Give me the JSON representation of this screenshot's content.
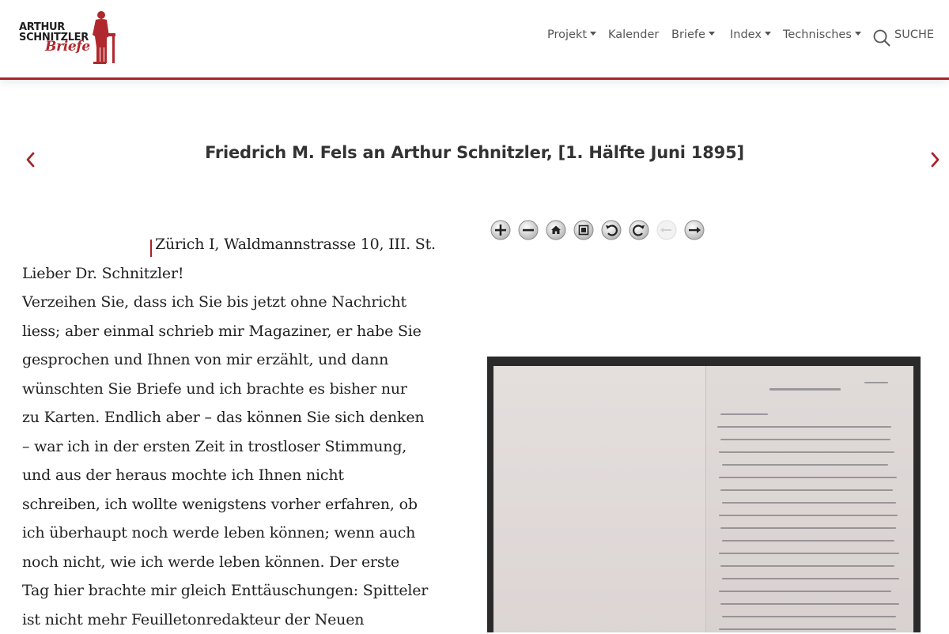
{
  "header": {
    "logo": {
      "line1": "ARTHUR",
      "line2": "SCHNITZLER",
      "line3": "Briefe"
    },
    "nav": [
      {
        "label": "Projekt",
        "dropdown": true
      },
      {
        "label": "Kalender",
        "dropdown": false
      },
      {
        "label": "Briefe",
        "dropdown": true
      },
      {
        "label": "Index",
        "dropdown": true
      },
      {
        "label": "Technisches",
        "dropdown": true
      }
    ],
    "search_label": "SUCHE"
  },
  "letter_title": "Friedrich M. Fels an Arthur Schnitzler, [1. Hälfte Juni 1895]",
  "letter": {
    "place": "Zürich I, Waldmannstrasse 10, III. St.",
    "lines": [
      "Lieber Dr. Schnitzler!",
      "Verzeihen Sie, dass ich Sie bis jetzt ohne Nachricht",
      "liess; aber einmal schrieb mir Magaziner, er habe Sie",
      "gesprochen und Ihnen von mir erzählt, und dann",
      "wünschten Sie Briefe und ich brachte es bisher nur",
      "zu Karten. Endlich aber – das können Sie sich denken",
      "– war ich in der ersten Zeit in trostloser Stimmung,",
      "und aus der heraus mochte ich Ihnen nicht",
      "schreiben, ich wollte wenigstens vorher erfahren, ob",
      "ich überhaupt noch werde leben können; wenn auch",
      "noch nicht, wie ich werde leben können. Der erste",
      "Tag hier brachte mir gleich Enttäuschungen: Spitteler",
      "ist nicht mehr Feuilletonredakteur der Neuen"
    ]
  },
  "viewer": {
    "tools": [
      "zoom-in-icon",
      "zoom-out-icon",
      "home-icon",
      "fullpage-icon",
      "rotate-left-icon",
      "rotate-right-icon",
      "previous-icon",
      "next-icon"
    ]
  },
  "colors": {
    "accent": "#a8232b",
    "nav_text": "#555555",
    "title_text": "#333333",
    "body_text": "#222222"
  }
}
